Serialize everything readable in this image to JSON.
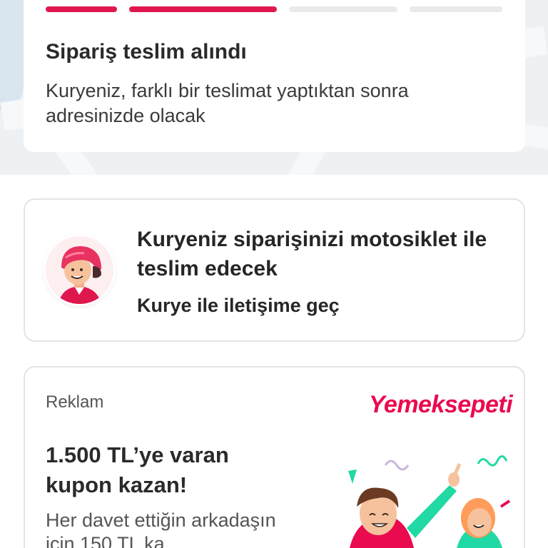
{
  "order_status": {
    "title": "Sipariş teslim alındı",
    "subtitle": "Kuryeniz, farklı bir teslimat yaptıktan sonra adresinizde olacak",
    "progress_steps": [
      {
        "state": "complete"
      },
      {
        "state": "complete"
      },
      {
        "state": "pending"
      },
      {
        "state": "pending"
      }
    ]
  },
  "courier": {
    "title": "Kuryeniz siparişinizi motosiklet ile teslim edecek",
    "contact_label": "Kurye ile iletişime geç",
    "avatar_icon": "courier-helmet-icon"
  },
  "ad": {
    "tag": "Reklam",
    "brand": "Yemeksepeti",
    "title": "1.500 TL’ye varan kupon kazan!",
    "body": "Her davet ettiğin arkadaşın için 150 TL ka"
  },
  "colors": {
    "accent": "#e0174f",
    "brand": "#ea0a4f",
    "progress_idle": "#e9eaec",
    "card_border": "#e3e4e6"
  }
}
